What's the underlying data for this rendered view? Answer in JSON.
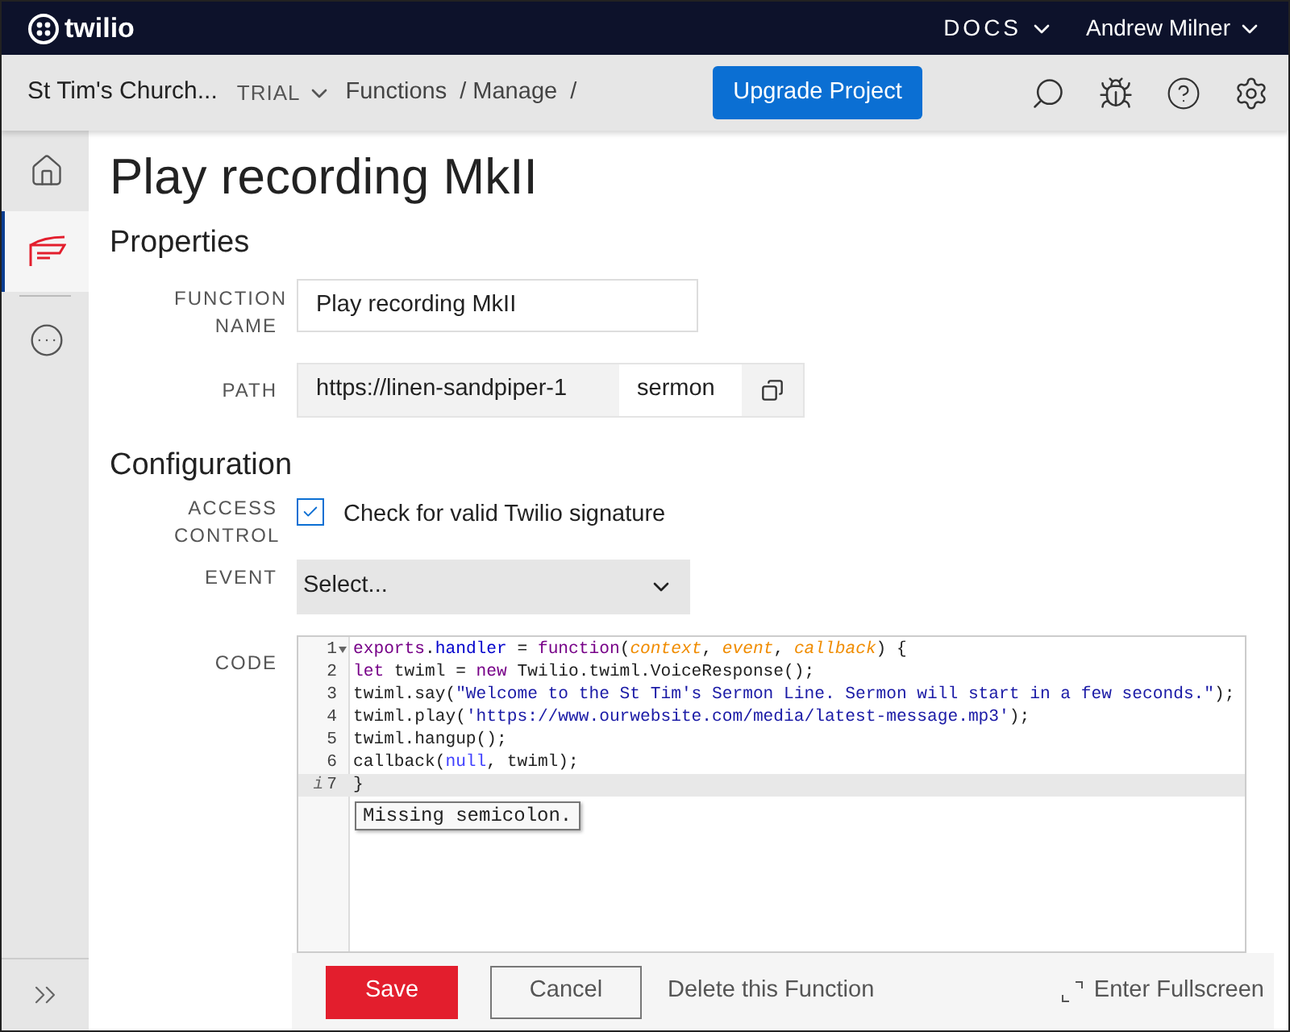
{
  "topbar": {
    "logo_text": "twilio",
    "docs": "DOCS",
    "user": "Andrew Milner"
  },
  "breadcrumb": {
    "project": "St Tim's Church...",
    "badge": "TRIAL",
    "items": [
      "Functions",
      "/ Manage",
      "/"
    ],
    "upgrade": "Upgrade Project"
  },
  "sidebar": {
    "items": [
      {
        "kind": "home",
        "selected": false
      },
      {
        "kind": "functions",
        "selected": true
      },
      {
        "kind": "more",
        "selected": false
      }
    ]
  },
  "title": "Play recording MkII",
  "properties": {
    "heading": "Properties",
    "function_name": {
      "label": "FUNCTION NAME",
      "value": "Play recording MkII"
    },
    "path": {
      "label": "PATH",
      "base": "https://linen-sandpiper-1",
      "value": "sermon"
    }
  },
  "configuration": {
    "heading": "Configuration",
    "access_control": {
      "label": "ACCESS CONTROL",
      "checked": true,
      "text": "Check for valid Twilio signature"
    },
    "event": {
      "label": "EVENT",
      "placeholder": "Select..."
    },
    "code_label": "CODE"
  },
  "code": {
    "lines": [
      {
        "number": "1",
        "foldable": true,
        "active": false,
        "tokens": [
          {
            "text": "exports",
            "kind": "keyword"
          },
          {
            "text": ".",
            "kind": "plain"
          },
          {
            "text": "handler",
            "kind": "prop"
          },
          {
            "text": " = ",
            "kind": "plain"
          },
          {
            "text": "function",
            "kind": "keyword"
          },
          {
            "text": "(",
            "kind": "plain"
          },
          {
            "text": "context",
            "kind": "param"
          },
          {
            "text": ", ",
            "kind": "plain"
          },
          {
            "text": "event",
            "kind": "param"
          },
          {
            "text": ", ",
            "kind": "plain"
          },
          {
            "text": "callback",
            "kind": "param"
          },
          {
            "text": ") {",
            "kind": "plain"
          }
        ]
      },
      {
        "number": "2",
        "active": false,
        "tokens": [
          {
            "text": "let",
            "kind": "keyword"
          },
          {
            "text": " twiml = ",
            "kind": "plain"
          },
          {
            "text": "new",
            "kind": "keyword"
          },
          {
            "text": " Twilio.twiml.VoiceResponse();",
            "kind": "plain"
          }
        ]
      },
      {
        "number": "3",
        "active": false,
        "tokens": [
          {
            "text": "twiml.say(",
            "kind": "plain"
          },
          {
            "text": "\"Welcome to the St Tim's Sermon Line. Sermon will start in a few seconds.\"",
            "kind": "string"
          },
          {
            "text": ");",
            "kind": "plain"
          }
        ]
      },
      {
        "number": "4",
        "active": false,
        "tokens": [
          {
            "text": "twiml.play(",
            "kind": "plain"
          },
          {
            "text": "'https://www.ourwebsite.com/media/latest-message.mp3'",
            "kind": "string"
          },
          {
            "text": ");",
            "kind": "plain"
          }
        ]
      },
      {
        "number": "5",
        "active": false,
        "tokens": [
          {
            "text": "twiml.hangup();",
            "kind": "plain"
          }
        ]
      },
      {
        "number": "6",
        "active": false,
        "tokens": [
          {
            "text": "callback(",
            "kind": "plain"
          },
          {
            "text": "null",
            "kind": "atom"
          },
          {
            "text": ", twiml);",
            "kind": "plain"
          }
        ]
      },
      {
        "number": "7",
        "marker": "i",
        "active": true,
        "tokens": [
          {
            "text": "}",
            "kind": "plain"
          }
        ]
      }
    ],
    "tooltip": "Missing semicolon."
  },
  "actions": {
    "save": "Save",
    "cancel": "Cancel",
    "delete": "Delete this Function",
    "fullscreen": "Enter Fullscreen"
  }
}
